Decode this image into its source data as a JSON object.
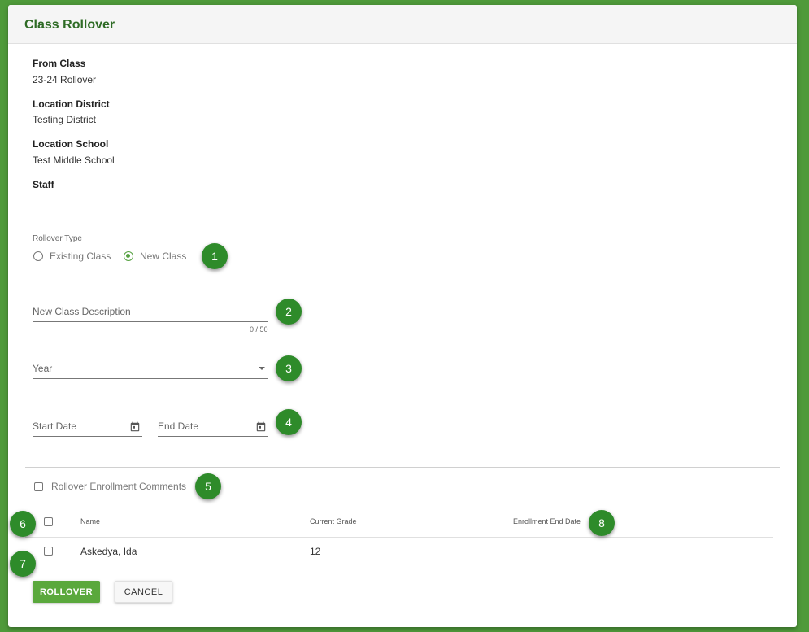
{
  "dialog": {
    "title": "Class Rollover"
  },
  "info": [
    {
      "label": "From Class",
      "value": "23-24 Rollover"
    },
    {
      "label": "Location District",
      "value": "Testing District"
    },
    {
      "label": "Location School",
      "value": "Test Middle School"
    },
    {
      "label": "Staff",
      "value": ""
    }
  ],
  "rollover_type": {
    "label": "Rollover Type",
    "options": [
      "Existing Class",
      "New Class"
    ],
    "selected": "New Class"
  },
  "new_class_description": {
    "placeholder": "New Class Description",
    "value": "",
    "counter": "0 / 50"
  },
  "year": {
    "placeholder": "Year",
    "value": ""
  },
  "start_date": {
    "placeholder": "Start Date",
    "value": ""
  },
  "end_date": {
    "placeholder": "End Date",
    "value": ""
  },
  "rollover_enrollment_comments": {
    "label": "Rollover Enrollment Comments",
    "checked": false
  },
  "table": {
    "columns": [
      "Name",
      "Current Grade",
      "Enrollment End Date"
    ],
    "rows": [
      {
        "name": "Askedya, Ida",
        "current_grade": "12",
        "enrollment_end_date": ""
      }
    ]
  },
  "actions": {
    "rollover": "ROLLOVER",
    "cancel": "CANCEL"
  },
  "callouts": [
    "1",
    "2",
    "3",
    "4",
    "5",
    "6",
    "7",
    "8"
  ],
  "colors": {
    "brand_green": "#5aa83c",
    "title_green": "#2e6b25",
    "callout_green": "#2e8b2a",
    "background": "#4f9a3a"
  }
}
